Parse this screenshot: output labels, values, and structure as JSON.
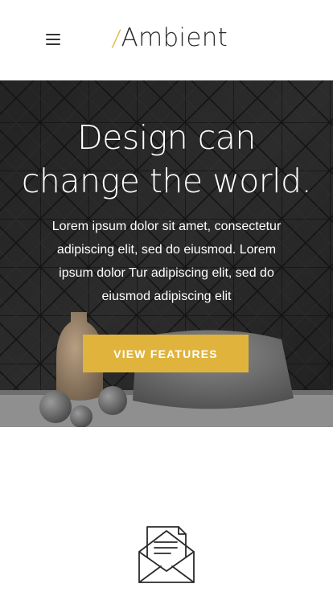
{
  "header": {
    "menu_icon": "hamburger-menu-icon",
    "logo": {
      "slash": "/",
      "name": "Ambient",
      "accent_color": "#e0b43c"
    }
  },
  "hero": {
    "title_line1": "Design can",
    "title_line2": "change the world.",
    "description": "Lorem ipsum dolor sit amet, consectetur adipiscing elit, sed do eiusmod. Lorem ipsum dolor Tur adipiscing elit, sed do eiusmod adipiscing elit",
    "cta_label": "VIEW FEATURES",
    "cta_color": "#e0b43c"
  },
  "features": {
    "icon": "envelope-letter-icon"
  }
}
